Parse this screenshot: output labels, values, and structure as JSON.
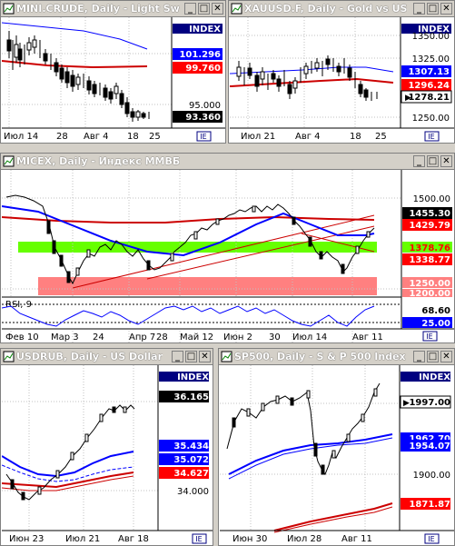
{
  "windows": {
    "minicrude": {
      "title": "MINI.CRUDE, Daily - Light Sw",
      "index_label": "INDEX",
      "prices": [
        "101.296",
        "99.760",
        "95.000",
        "93.360"
      ],
      "x_labels": [
        "Июл 14",
        "28",
        "Авг 4",
        "18",
        "25"
      ]
    },
    "xauusd": {
      "title": "XAUUSD.F, Daily - Gold vs US",
      "index_label": "INDEX",
      "prices": [
        "1350.00",
        "1325.00",
        "1307.13",
        "1296.24",
        "1278.21",
        "1250.00"
      ],
      "x_labels": [
        "Июл 21",
        "Авг 4",
        "18",
        "25"
      ]
    },
    "micex": {
      "title": "MICEX, Daily - Индекс ММВБ",
      "prices": [
        "1500.00",
        "1455.30",
        "1429.79",
        "1378.76",
        "1338.77",
        "1250.00",
        "1200.00"
      ],
      "rsi_title": "RSI, 9",
      "rsi_values": [
        "68.60",
        "25.00"
      ],
      "x_labels": [
        "Фев 10",
        "Мар 3",
        "24",
        "Апр 7",
        "28",
        "Май 12",
        "Июн 2",
        "30",
        "Июл 14",
        "Авг 11"
      ]
    },
    "usdrub": {
      "title": "USDRUB, Daily - US Dollar",
      "index_label": "INDEX",
      "prices": [
        "36.165",
        "35.434",
        "35.072",
        "34.627",
        "34.000"
      ],
      "x_labels": [
        "Июн 23",
        "Июл 21",
        "Авг 18"
      ]
    },
    "sp500": {
      "title": "SP500, Daily - S & P 500 Index",
      "index_label": "INDEX",
      "prices": [
        "1997.00",
        "1962.70",
        "1954.07",
        "1900.00",
        "1871.87"
      ],
      "x_labels": [
        "Июн 30",
        "Июл 28",
        "Авг 11"
      ]
    }
  },
  "colors": {
    "title_bg": "#d4d0c8",
    "price_blue": "#0000ff",
    "price_red": "#ff0000",
    "green_zone": "#66ff00",
    "pink_zone": "#ff8080",
    "black": "#000000"
  }
}
